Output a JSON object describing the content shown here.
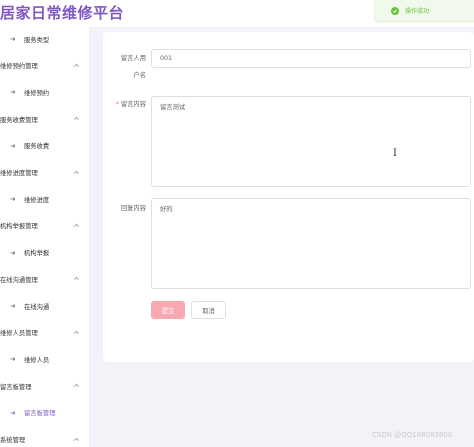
{
  "header": {
    "title": "居家日常维修平台"
  },
  "toast": {
    "message": "操作成功",
    "color": "#67c23a"
  },
  "sidebar": {
    "items": [
      {
        "type": "sub",
        "label": "服务类型"
      },
      {
        "type": "group",
        "label": "维修预约管理"
      },
      {
        "type": "sub",
        "label": "维修预约"
      },
      {
        "type": "group",
        "label": "服务收费管理"
      },
      {
        "type": "sub",
        "label": "服务收费"
      },
      {
        "type": "group",
        "label": "维修进度管理"
      },
      {
        "type": "sub",
        "label": "维修进度"
      },
      {
        "type": "group",
        "label": "机构举报管理"
      },
      {
        "type": "sub",
        "label": "机构举报"
      },
      {
        "type": "group",
        "label": "在线沟通管理"
      },
      {
        "type": "sub",
        "label": "在线沟通"
      },
      {
        "type": "group",
        "label": "维修人员管理"
      },
      {
        "type": "sub",
        "label": "维修人员"
      },
      {
        "type": "group",
        "label": "留言板管理"
      },
      {
        "type": "sub",
        "label": "留言板管理",
        "active": true
      },
      {
        "type": "group",
        "label": "系统管理"
      }
    ],
    "accent": "#7f57c4"
  },
  "form": {
    "username_label_line1": "留言人用",
    "username_label_line2": "户名",
    "username_value": "001",
    "content_label": "留言内容",
    "content_required_mark": "*",
    "content_value": "留言测试",
    "reply_label": "回复内容",
    "reply_value": "好的",
    "submit_label": "提交",
    "cancel_label": "取消"
  },
  "watermark": "CSDN @QQ188083800"
}
